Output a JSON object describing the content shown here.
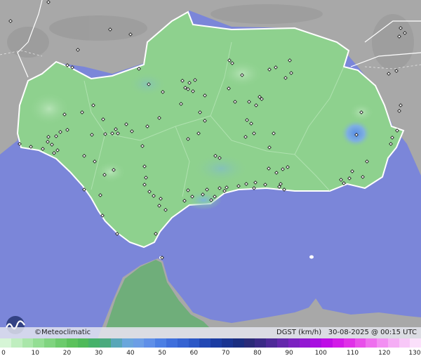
{
  "credit": "©Meteoclimatic",
  "parameter_label": "DGST (km/h)",
  "timestamp": "30-08-2025 @ 00:15 UTC",
  "logo_icon": "meteoclimatic-wave-logo",
  "colors": {
    "sea": "#7b86d9",
    "land_outside": "#a8a8a8",
    "region_fill": "#8ed18e",
    "africa_land": "#6fae7a",
    "borders": "#ffffff",
    "station_dot": "#ffffff"
  },
  "scale": {
    "ticks": [
      "0",
      "10",
      "20",
      "30",
      "40",
      "50",
      "60",
      "70",
      "80",
      "90",
      "100",
      "110",
      "120",
      "130"
    ],
    "colors": [
      "#d6f5d6",
      "#bfeebf",
      "#a9e6a9",
      "#93de93",
      "#7fd47f",
      "#6ccb6c",
      "#5cc25c",
      "#4fba5a",
      "#46b26a",
      "#4aaa7e",
      "#58a6b8",
      "#6aa6dc",
      "#6c9ee6",
      "#5f8fe8",
      "#4c7fe4",
      "#3f6fdc",
      "#3563d2",
      "#2b57c6",
      "#2248b4",
      "#1b3ca2",
      "#193391",
      "#1a2d80",
      "#2a2a78",
      "#3a2a86",
      "#4e2a98",
      "#6428ac",
      "#7b22c0",
      "#9218d2",
      "#a80fe0",
      "#be0de6",
      "#d21ae8",
      "#e030e8",
      "#e84fea",
      "#ee70ee",
      "#f28ff2",
      "#f5aef5",
      "#f8c8f8",
      "#fbe0fb"
    ]
  }
}
